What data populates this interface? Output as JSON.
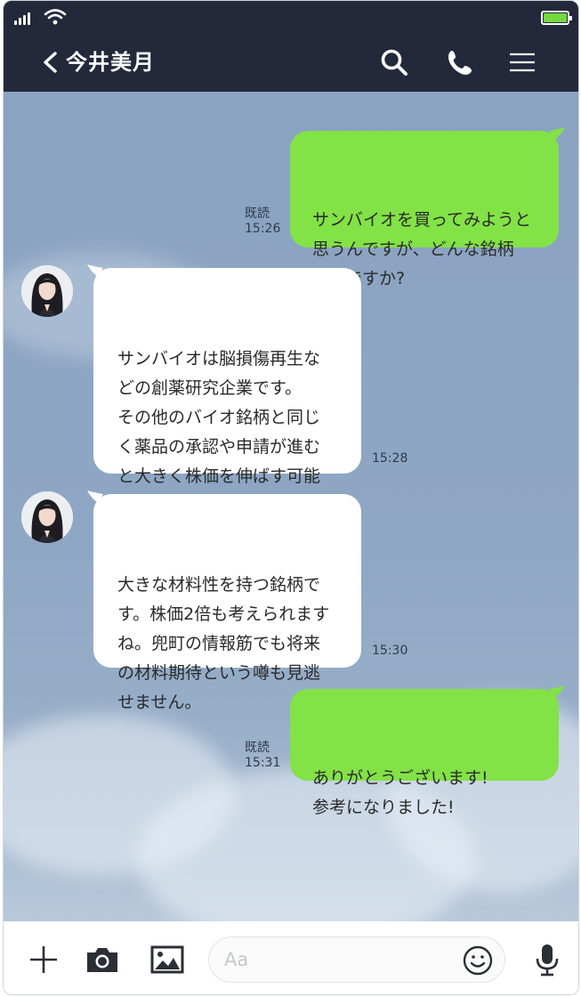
{
  "header": {
    "contact_name": "今井美月"
  },
  "messages": [
    {
      "side": "me",
      "text": "サンバイオを買ってみようと\n思うんですが、どんな銘柄\nなんですか?",
      "read": "既読",
      "time": "15:26"
    },
    {
      "side": "them",
      "text": "サンバイオは脳損傷再生な\nどの創薬研究企業です。\nその他のバイオ銘柄と同じ\nく薬品の承認や申請が進む\nと大きく株価を伸ばす可能\n性があります。",
      "time": "15:28"
    },
    {
      "side": "them",
      "text": "大きな材料性を持つ銘柄で\nす。株価2倍も考えられます\nね。兜町の情報筋でも将来\nの材料期待という噂も見逃\nせません。",
      "time": "15:30"
    },
    {
      "side": "me",
      "text": "ありがとうございます!\n参考になりました!",
      "read": "既読",
      "time": "15:31"
    }
  ],
  "input": {
    "placeholder": "Aa"
  },
  "colors": {
    "header": "#23293b",
    "my_bubble": "#82e246",
    "their_bubble": "#ffffff",
    "battery": "#72d93f"
  },
  "icons": [
    "signal-icon",
    "wifi-icon",
    "battery-icon",
    "back-chevron-icon",
    "search-icon",
    "phone-call-icon",
    "menu-icon",
    "plus-icon",
    "camera-icon",
    "image-icon",
    "emoji-icon",
    "microphone-icon"
  ]
}
